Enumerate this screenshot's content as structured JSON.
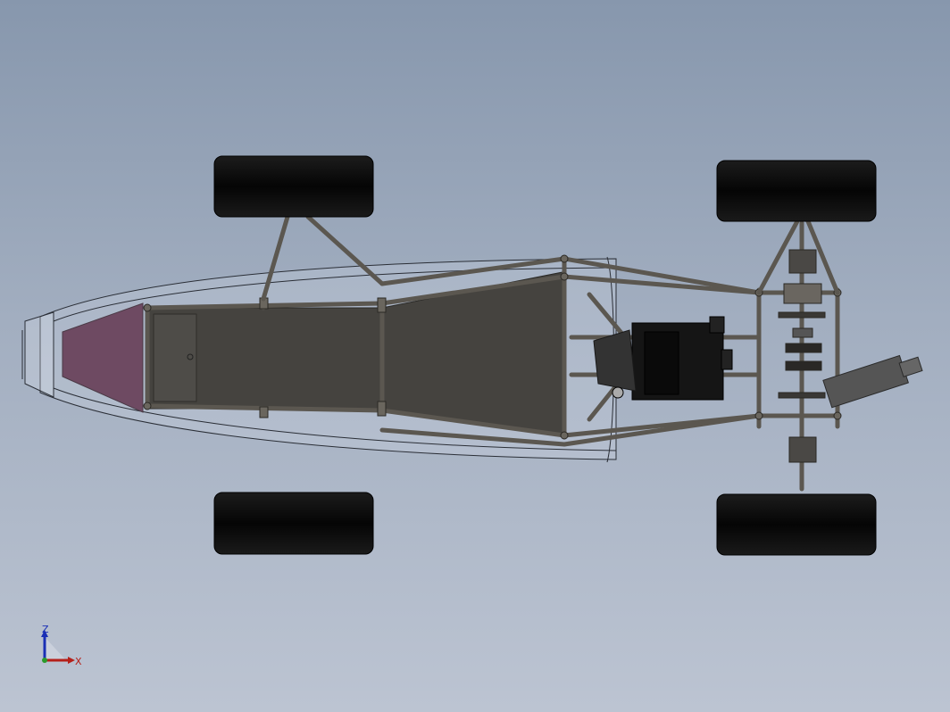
{
  "view": {
    "model": "formula-car-chassis-top-view",
    "colors": {
      "background_top": "#8797ad",
      "background_bottom": "#bcc4d2",
      "tire": "#0a0a0a",
      "frame_tube": "#5b5750",
      "floor_panel": "#45433f",
      "nose_cone": "#6e4a62",
      "engine": "#151515"
    }
  },
  "triad": {
    "z_label": "Z",
    "x_label": "X",
    "z_color": "#1a2fb5",
    "x_color": "#b5201a"
  }
}
